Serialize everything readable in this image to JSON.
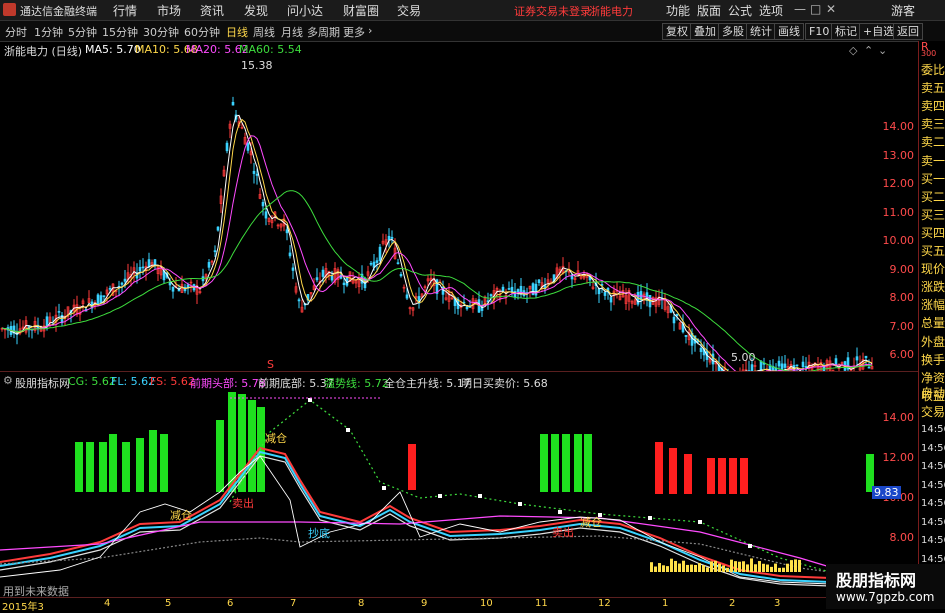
{
  "app": {
    "title": "通达信金融终端",
    "guest": "游客"
  },
  "menu": [
    "行情",
    "市场",
    "资讯",
    "发现",
    "问小达",
    "财富圈",
    "交易"
  ],
  "status": {
    "login_msg": "证券交易未登录",
    "stock_name": "浙能电力"
  },
  "rmenu": [
    "功能",
    "版面",
    "公式",
    "选项"
  ],
  "window_controls": [
    "—",
    "□",
    "✕"
  ],
  "timeframes": [
    "分时",
    "1分钟",
    "5分钟",
    "15分钟",
    "30分钟",
    "60分钟",
    "日线",
    "周线",
    "月线",
    "多周期",
    "更多"
  ],
  "toolbar_right": [
    "复权",
    "叠加",
    "多股",
    "统计",
    "画线",
    "F10",
    "标记",
    "+自选",
    "返回"
  ],
  "main": {
    "title": "浙能电力 (日线)",
    "ma5": "MA5: 5.70",
    "ma10": "MA10: 5.68",
    "ma20": "MA20: 5.62",
    "ma60": "MA60: 5.54",
    "high_label": "15.38",
    "low_label": "5.00",
    "yticks": [
      "14.00",
      "13.00",
      "12.00",
      "11.00",
      "10.00",
      "9.00",
      "8.00",
      "7.00",
      "6.00"
    ],
    "corner_r": "R",
    "corner_num": "300"
  },
  "indicator": {
    "name": "股朋指标网",
    "cg": "CG: 5.62",
    "fl": "FL: 5.62",
    "fs": "FS: 5.62",
    "prev_top": "前期头部: 5.78",
    "prev_bottom": "前期底部: 5.37",
    "strong": "强势线: 5.72",
    "full_line": "全仓主升线: 5.17",
    "tomorrow": "明日买卖价: 5.68",
    "yticks": [
      "14.00",
      "12.00",
      "10.00",
      "8.00"
    ],
    "current_value": "9.83",
    "lbl_jiancang1": "减仓",
    "lbl_jiancang2": "减仓",
    "lbl_jiancang3": "减仓",
    "lbl_buy": "抄底",
    "lbl_sell1": "卖出",
    "lbl_sell2": "卖出",
    "lbl_s": "S"
  },
  "future_btn": "用到未来数据",
  "dates": [
    "2015年3",
    "4",
    "5",
    "6",
    "7",
    "8",
    "9",
    "10",
    "11",
    "12",
    "1",
    "2",
    "3"
  ],
  "sidebar": [
    "委比",
    "卖五",
    "卖四",
    "卖三",
    "卖二",
    "卖一",
    "买一",
    "买二",
    "买三",
    "买四",
    "买五",
    "现价",
    "涨跌",
    "涨幅",
    "总量",
    "外盘",
    "换手",
    "净资",
    "收益"
  ],
  "sidebar_lower": [
    "自动",
    "交易",
    "14:56",
    "14:56",
    "14:56",
    "14:56",
    "14:56",
    "14:56",
    "14:56",
    "14:56",
    "14:56",
    "14:56"
  ],
  "watermark": {
    "title": "股朋指标网",
    "url": "www.7gpzb.com"
  },
  "colors": {
    "up": "#ff3b3b",
    "down": "#3ad3ff",
    "ma5": "#ffffff",
    "ma10": "#ffd84a",
    "ma20": "#ff4bff",
    "ma60": "#3ddc3d",
    "green_bar": "#1fe01f",
    "red_bar": "#ff1f1f"
  }
}
